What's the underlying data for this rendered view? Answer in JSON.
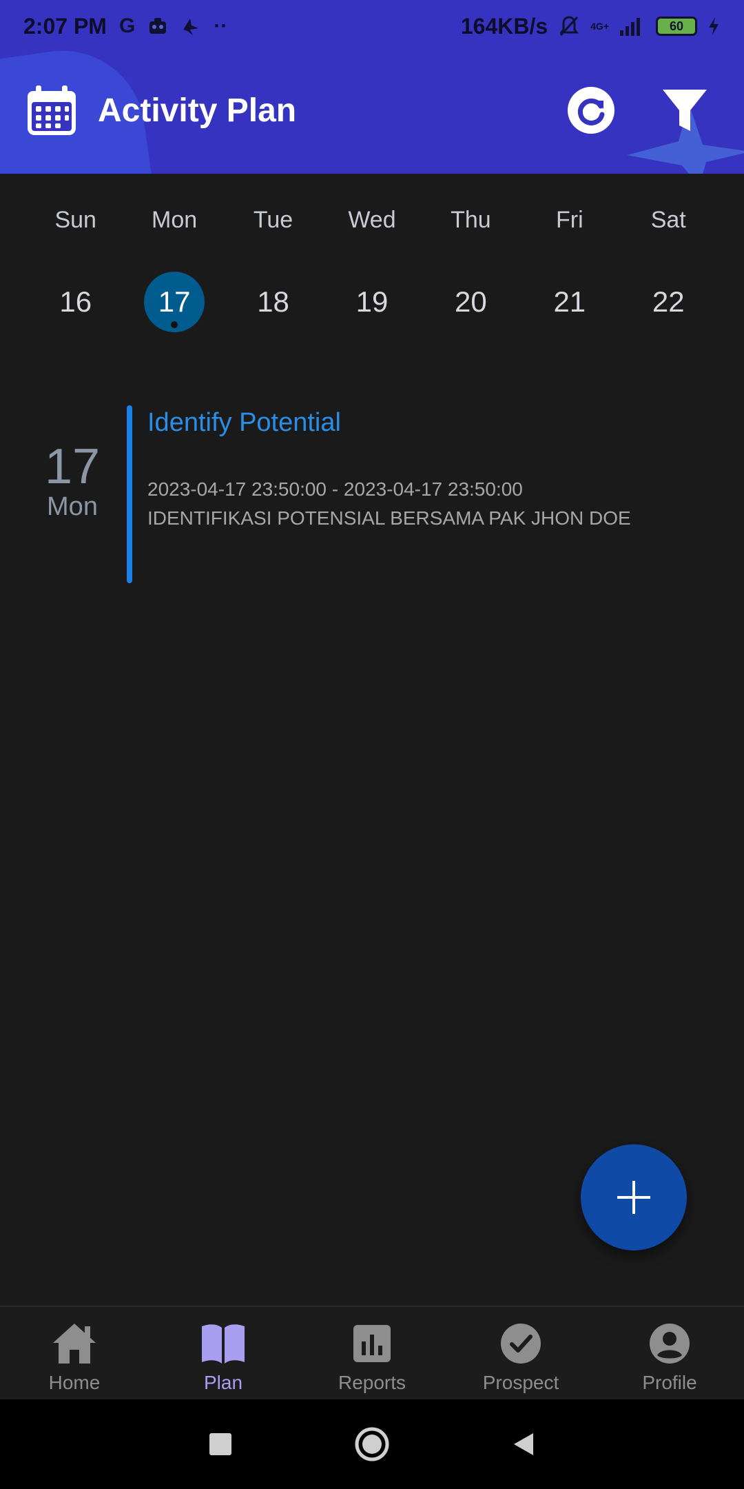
{
  "status_bar": {
    "time": "2:07 PM",
    "left_icons": [
      "google-g-icon",
      "robot-app-icon",
      "bird-app-icon",
      "more-dots-icon"
    ],
    "network_speed": "164KB/s",
    "network_type": "4G+",
    "battery_level": "60"
  },
  "app_bar": {
    "title": "Activity Plan",
    "refresh_icon": "refresh-icon",
    "filter_icon": "filter-icon",
    "colors": {
      "background": "#3533c0",
      "title": "#ffffff"
    }
  },
  "week": {
    "days": [
      {
        "name": "Sun",
        "num": "16"
      },
      {
        "name": "Mon",
        "num": "17"
      },
      {
        "name": "Tue",
        "num": "18"
      },
      {
        "name": "Wed",
        "num": "19"
      },
      {
        "name": "Thu",
        "num": "20"
      },
      {
        "name": "Fri",
        "num": "21"
      },
      {
        "name": "Sat",
        "num": "22"
      }
    ],
    "selected_num": "17",
    "selected_color": "#005c8e"
  },
  "event": {
    "date_num": "17",
    "date_day": "Mon",
    "title": "Identify Potential",
    "time_range": "2023-04-17 23:50:00 - 2023-04-17 23:50:00",
    "description": "IDENTIFIKASI POTENSIAL  BERSAMA PAK JHON DOE",
    "accent_color": "#1a82e6"
  },
  "fab": {
    "icon": "plus-icon",
    "color": "#0f4aa7"
  },
  "bottom_nav": {
    "items": [
      {
        "label": "Home",
        "icon": "home-icon"
      },
      {
        "label": "Plan",
        "icon": "book-icon"
      },
      {
        "label": "Reports",
        "icon": "bar-chart-icon"
      },
      {
        "label": "Prospect",
        "icon": "check-circle-icon"
      },
      {
        "label": "Profile",
        "icon": "account-circle-icon"
      }
    ],
    "active": "Plan",
    "active_color": "#a99ef0"
  },
  "system_nav": {
    "buttons": [
      "recents-square-icon",
      "home-circle-icon",
      "back-triangle-icon"
    ]
  }
}
